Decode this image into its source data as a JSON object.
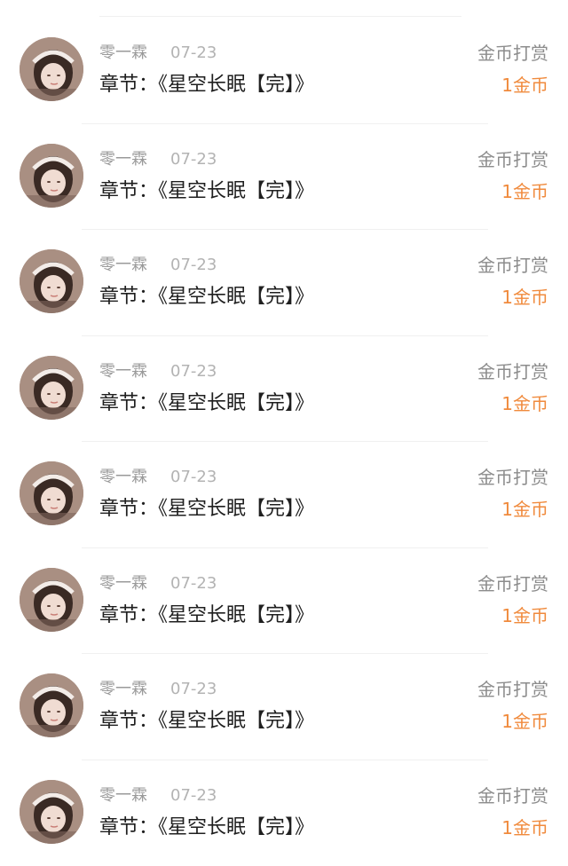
{
  "records": [
    {
      "user": "零一霖",
      "date": "07-23",
      "chapter_prefix": "章节：",
      "chapter_title": "《星空长眠【完】》",
      "reward_type": "金币打赏",
      "reward_amount": "1金币"
    },
    {
      "user": "零一霖",
      "date": "07-23",
      "chapter_prefix": "章节：",
      "chapter_title": "《星空长眠【完】》",
      "reward_type": "金币打赏",
      "reward_amount": "1金币"
    },
    {
      "user": "零一霖",
      "date": "07-23",
      "chapter_prefix": "章节：",
      "chapter_title": "《星空长眠【完】》",
      "reward_type": "金币打赏",
      "reward_amount": "1金币"
    },
    {
      "user": "零一霖",
      "date": "07-23",
      "chapter_prefix": "章节：",
      "chapter_title": "《星空长眠【完】》",
      "reward_type": "金币打赏",
      "reward_amount": "1金币"
    },
    {
      "user": "零一霖",
      "date": "07-23",
      "chapter_prefix": "章节：",
      "chapter_title": "《星空长眠【完】》",
      "reward_type": "金币打赏",
      "reward_amount": "1金币"
    },
    {
      "user": "零一霖",
      "date": "07-23",
      "chapter_prefix": "章节：",
      "chapter_title": "《星空长眠【完】》",
      "reward_type": "金币打赏",
      "reward_amount": "1金币"
    },
    {
      "user": "零一霖",
      "date": "07-23",
      "chapter_prefix": "章节：",
      "chapter_title": "《星空长眠【完】》",
      "reward_type": "金币打赏",
      "reward_amount": "1金币"
    },
    {
      "user": "零一霖",
      "date": "07-23",
      "chapter_prefix": "章节：",
      "chapter_title": "《星空长眠【完】》",
      "reward_type": "金币打赏",
      "reward_amount": "1金币"
    }
  ],
  "colors": {
    "username": "#9a9a9a",
    "date": "#b3b3b3",
    "chapter": "#1f1f1f",
    "reward_type": "#8c8c8c",
    "reward_amount": "#f08a3c"
  },
  "icons": {
    "avatar": "user-avatar-photo"
  }
}
